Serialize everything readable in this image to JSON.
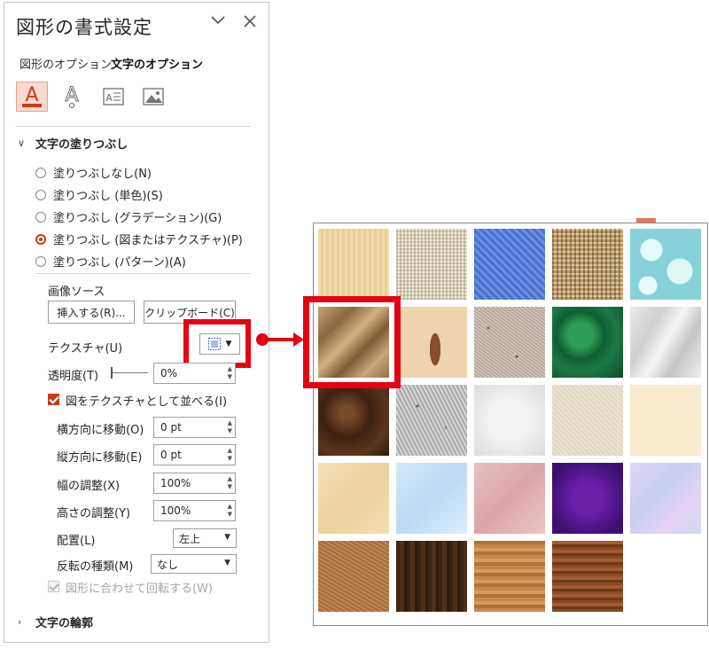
{
  "pane": {
    "title": "図形の書式設定",
    "tabs": [
      "図形のオプション",
      "文字のオプション"
    ],
    "icons": [
      "text-fill-outline-icon",
      "text-effects-icon",
      "textbox-icon",
      "picture-icon"
    ]
  },
  "fill_section": {
    "title": "文字の塗りつぶし",
    "options": [
      "塗りつぶしなし(N)",
      "塗りつぶし (単色)(S)",
      "塗りつぶし (グラデーション)(G)",
      "塗りつぶし (図またはテクスチャ)(P)",
      "塗りつぶし (パターン)(A)"
    ],
    "selected_index": 3
  },
  "image_source": {
    "label": "画像ソース",
    "insert_button": "挿入する(R)...",
    "clipboard_button": "クリップボード(C)"
  },
  "texture": {
    "label": "テクスチャ(U)"
  },
  "transparency": {
    "label": "透明度(T)",
    "value": "0%",
    "level": 0
  },
  "tile_checkbox": {
    "label": "図をテクスチャとして並べる(I)",
    "checked": true
  },
  "offsets": {
    "x_label": "横方向に移動(O)",
    "x_value": "0 pt",
    "y_label": "縦方向に移動(E)",
    "y_value": "0 pt"
  },
  "scale": {
    "x_label": "幅の調整(X)",
    "x_value": "100%",
    "y_label": "高さの調整(Y)",
    "y_value": "100%"
  },
  "alignment": {
    "label": "配置(L)",
    "value": "左上"
  },
  "mirror": {
    "label": "反転の種類(M)",
    "value": "なし"
  },
  "rotate_checkbox": {
    "label": "図形に合わせて回転する(W)",
    "checked": true,
    "disabled": true
  },
  "outline_section": {
    "title": "文字の輪郭"
  },
  "gallery": {
    "textures": [
      "papyrus",
      "canvas",
      "denim",
      "burlap",
      "water-droplets",
      "crumpled-paper",
      "fossil",
      "granite",
      "green-marble",
      "white-marble",
      "brown-marble",
      "gravel",
      "white-speckled",
      "sand",
      "cream",
      "parchment",
      "blue-tissue",
      "pink-tissue",
      "purple-mesh",
      "bouquet",
      "cork",
      "walnut",
      "oak",
      "medium-wood"
    ],
    "selected": "crumpled-paper"
  },
  "colors": {
    "accent": "#c43e1c",
    "highlight_red": "#e50012"
  }
}
